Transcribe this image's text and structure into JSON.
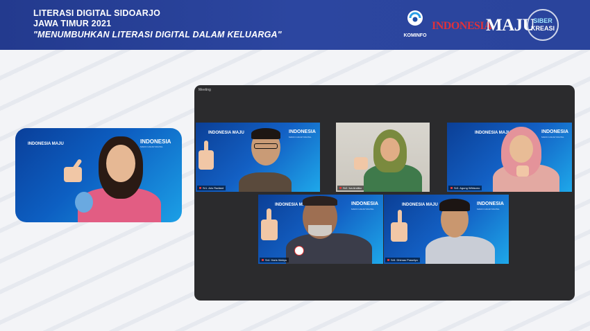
{
  "header": {
    "line1": "LITERASI DIGITAL SIDOARJO",
    "line2": "JAWA TIMUR 2021",
    "line3": "\"MENUMBUHKAN LITERASI DIGITAL DALAM KELUARGA\"",
    "logos": {
      "kominfo": "KOMINFO",
      "indonesia": "INDONESIA",
      "maju": "MAJU",
      "siber": "SIBER",
      "kreasi": "KREASI"
    }
  },
  "presenter": {
    "banner_logo": "INDONESIA MAJU",
    "banner_title": "INDONESIA",
    "banner_sub": "MAKIN CAKAP DIGITAL"
  },
  "meeting": {
    "window_label": "Meeting",
    "participants": [
      {
        "name": "Sr1. Aris Radiant",
        "banner_logo": "INDONESIA MAJU",
        "banner_title": "INDONESIA"
      },
      {
        "name": "Sr2. Iva Andiko"
      },
      {
        "name": "Sr3. Agung Wibisono",
        "banner_logo": "INDONESIA MAJU",
        "banner_title": "INDONESIA"
      },
      {
        "name": "Sr4. Haris Wahyu",
        "banner_logo": "INDONESIA MAJU",
        "banner_title": "INDONESIA"
      },
      {
        "name": "Sr5. Dhimas Prasetyo",
        "banner_logo": "INDONESIA MAJU",
        "banner_title": "INDONESIA"
      }
    ],
    "banner_sub": "MAKIN CAKAP DIGITAL"
  },
  "colors": {
    "header_bg": "#2a449c",
    "accent_red": "#e0313b",
    "window_bg": "#2b2b2d"
  }
}
